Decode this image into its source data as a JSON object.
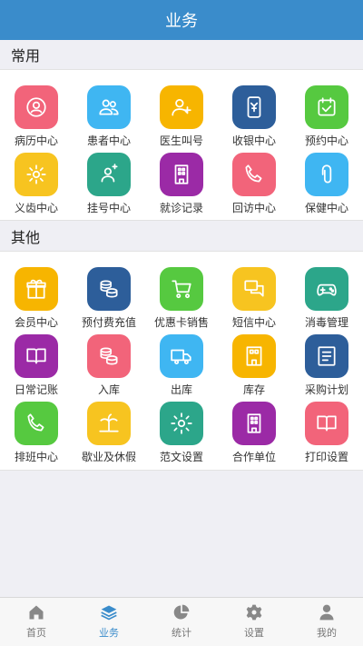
{
  "header": {
    "title": "业务"
  },
  "sections": [
    {
      "title": "常用",
      "items": [
        {
          "label": "病历中心",
          "icon": "patient-record-icon",
          "color": "#f2647a"
        },
        {
          "label": "患者中心",
          "icon": "patients-icon",
          "color": "#3fb6f2"
        },
        {
          "label": "医生叫号",
          "icon": "doctor-call-icon",
          "color": "#f7b500"
        },
        {
          "label": "收银中心",
          "icon": "cashier-icon",
          "color": "#2d5e9a"
        },
        {
          "label": "预约中心",
          "icon": "appointment-icon",
          "color": "#56c940"
        },
        {
          "label": "义齿中心",
          "icon": "denture-gear-icon",
          "color": "#f7c420"
        },
        {
          "label": "挂号中心",
          "icon": "registration-icon",
          "color": "#2ca68a"
        },
        {
          "label": "就诊记录",
          "icon": "visit-record-icon",
          "color": "#9b2aa6"
        },
        {
          "label": "回访中心",
          "icon": "phone-icon",
          "color": "#f2647a"
        },
        {
          "label": "保健中心",
          "icon": "paperclip-icon",
          "color": "#3fb6f2"
        }
      ]
    },
    {
      "title": "其他",
      "items": [
        {
          "label": "会员中心",
          "icon": "gift-icon",
          "color": "#f7b500"
        },
        {
          "label": "预付费充值",
          "icon": "coins-icon",
          "color": "#2d5e9a"
        },
        {
          "label": "优惠卡销售",
          "icon": "cart-icon",
          "color": "#56c940"
        },
        {
          "label": "短信中心",
          "icon": "message-icon",
          "color": "#f7c420"
        },
        {
          "label": "消毒管理",
          "icon": "gamepad-icon",
          "color": "#2ca68a"
        },
        {
          "label": "日常记账",
          "icon": "book-icon",
          "color": "#9b2aa6"
        },
        {
          "label": "入库",
          "icon": "coins-icon",
          "color": "#f2647a"
        },
        {
          "label": "出库",
          "icon": "truck-icon",
          "color": "#3fb6f2"
        },
        {
          "label": "库存",
          "icon": "inventory-icon",
          "color": "#f7b500"
        },
        {
          "label": "采购计划",
          "icon": "list-icon",
          "color": "#2d5e9a"
        },
        {
          "label": "排班中心",
          "icon": "phone-icon",
          "color": "#56c940"
        },
        {
          "label": "歇业及休假",
          "icon": "beach-icon",
          "color": "#f7c420"
        },
        {
          "label": "范文设置",
          "icon": "gear-icon",
          "color": "#2ca68a"
        },
        {
          "label": "合作单位",
          "icon": "building-icon",
          "color": "#9b2aa6"
        },
        {
          "label": "打印设置",
          "icon": "book-icon",
          "color": "#f2647a"
        }
      ]
    }
  ],
  "tabbar": [
    {
      "label": "首页",
      "icon": "home-icon",
      "active": false
    },
    {
      "label": "业务",
      "icon": "layers-icon",
      "active": true
    },
    {
      "label": "统计",
      "icon": "pie-chart-icon",
      "active": false
    },
    {
      "label": "设置",
      "icon": "gear-icon",
      "active": false
    },
    {
      "label": "我的",
      "icon": "user-icon",
      "active": false
    }
  ],
  "colors": {
    "primary": "#3a8ccb",
    "tab_inactive": "#888888"
  }
}
